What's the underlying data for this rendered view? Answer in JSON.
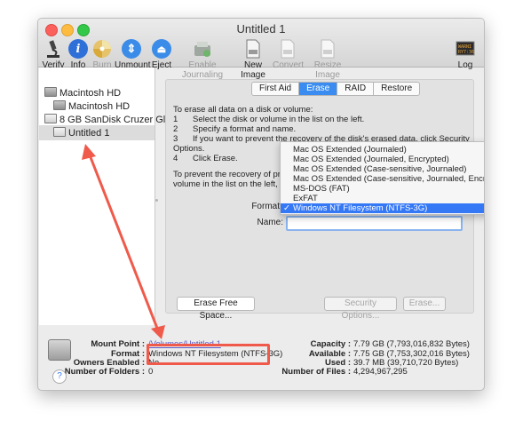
{
  "window": {
    "title": "Untitled 1"
  },
  "toolbar": {
    "items": [
      {
        "label": "Verify",
        "icon": "microscope-icon",
        "enabled": true
      },
      {
        "label": "Info",
        "icon": "info-icon",
        "enabled": true
      },
      {
        "label": "Burn",
        "icon": "burn-icon",
        "enabled": false
      },
      {
        "label": "Unmount",
        "icon": "unmount-icon",
        "enabled": true
      },
      {
        "label": "Eject",
        "icon": "eject-icon",
        "enabled": true
      },
      {
        "label": "Enable Journaling",
        "icon": "journaling-icon",
        "enabled": false
      },
      {
        "label": "New Image",
        "icon": "new-image-icon",
        "enabled": true
      },
      {
        "label": "Convert",
        "icon": "convert-icon",
        "enabled": false
      },
      {
        "label": "Resize Image",
        "icon": "resize-image-icon",
        "enabled": false
      },
      {
        "label": "Log",
        "icon": "log-icon",
        "enabled": true
      }
    ]
  },
  "sidebar": {
    "items": [
      {
        "label": "Macintosh HD",
        "level": 0
      },
      {
        "label": "Macintosh HD",
        "level": 1
      },
      {
        "label": "8 GB SanDisk Cruzer Gli...",
        "level": 0
      },
      {
        "label": "Untitled 1",
        "level": 1,
        "selected": true
      }
    ]
  },
  "tabs": [
    {
      "label": "First Aid",
      "active": false
    },
    {
      "label": "Erase",
      "active": true
    },
    {
      "label": "RAID",
      "active": false
    },
    {
      "label": "Restore",
      "active": false
    }
  ],
  "instructions": {
    "line0": "To erase all data on a disk or volume:",
    "s1n": "1",
    "s1": "Select the disk or volume in the list on the left.",
    "s2n": "2",
    "s2": "Specify a format and name.",
    "s3n": "3",
    "s3": "If you want to prevent the recovery of the disk's erased data, click Security",
    "s3b": "Options.",
    "s4n": "4",
    "s4": "Click Erase.",
    "p2a": "To prevent the recovery of previc",
    "p2b": "volume in the list on the left, and"
  },
  "form": {
    "format_label": "Format",
    "name_label": "Name:",
    "name_value": ""
  },
  "format_menu": {
    "options": [
      "Mac OS Extended (Journaled)",
      "Mac OS Extended (Journaled, Encrypted)",
      "Mac OS Extended (Case-sensitive, Journaled)",
      "Mac OS Extended (Case-sensitive, Journaled, Encrypted)",
      "MS-DOS (FAT)",
      "ExFAT",
      "Windows NT Filesystem (NTFS-3G)"
    ],
    "selected_index": 6,
    "check": "✓"
  },
  "buttons": {
    "erase_free_space": "Erase Free Space...",
    "security_options": "Security Options...",
    "erase": "Erase..."
  },
  "info": {
    "mount_point_label": "Mount Point :",
    "mount_point_value": "/Volumes/Untitled 1",
    "format_label": "Format :",
    "format_value": "Windows NT Filesystem (NTFS-3G)",
    "owners_label": "Owners Enabled :",
    "owners_value": "No",
    "folders_label": "Number of Folders :",
    "folders_value": "0",
    "capacity_label": "Capacity :",
    "capacity_value": "7.79 GB (7,793,016,832 Bytes)",
    "available_label": "Available :",
    "available_value": "7.75 GB (7,753,302,016 Bytes)",
    "used_label": "Used :",
    "used_value": "39.7 MB (39,710,720 Bytes)",
    "files_label": "Number of Files :",
    "files_value": "4,294,967,295"
  },
  "help": {
    "label": "?"
  },
  "colors": {
    "accent": "#3478f6",
    "annotation": "#ef5a4b"
  }
}
